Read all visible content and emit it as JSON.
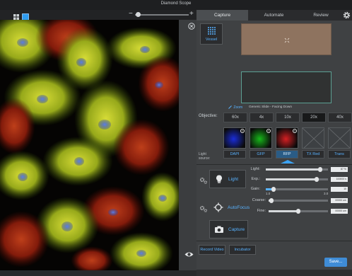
{
  "window": {
    "title": "Diamond Scope"
  },
  "view": {
    "zoom_minus": "−",
    "zoom_plus": "+",
    "zoom_level": 0.05,
    "grid_icon": "grid-view-icon",
    "single_icon": "single-view-icon"
  },
  "tabs": [
    {
      "label": "Capture",
      "active": true
    },
    {
      "label": "Automate",
      "active": false
    },
    {
      "label": "Review",
      "active": false
    }
  ],
  "vessel": {
    "label": "Vessel"
  },
  "slide": {
    "zoom_link": "Zoom",
    "caption": "Generic Slide - Facing Down"
  },
  "objective": {
    "label": "Objective:",
    "options": [
      {
        "label": "60x",
        "active": false
      },
      {
        "label": "4x",
        "active": false
      },
      {
        "label": "10x",
        "active": false
      },
      {
        "label": "20x",
        "active": true
      },
      {
        "label": "40x",
        "active": false
      }
    ]
  },
  "light_source": {
    "label_line1": "Light",
    "label_line2": "source:",
    "filters": [
      {
        "label": "DAPI",
        "color": "#1a2dd8",
        "active": false,
        "empty": false
      },
      {
        "label": "GFP",
        "color": "#17b81a",
        "active": false,
        "empty": false
      },
      {
        "label": "RFP",
        "color": "#d41f22",
        "active": true,
        "empty": false
      },
      {
        "label": "TX Red",
        "color": "#3d4043",
        "active": false,
        "empty": true
      },
      {
        "label": "Trans",
        "color": "#3d4043",
        "active": false,
        "empty": true
      }
    ]
  },
  "light": {
    "button_label": "Light",
    "sliders": [
      {
        "label": "Light:",
        "value": "87 %",
        "level": 0.87
      },
      {
        "label": "Exp.:",
        "value": "100000 s",
        "level": 0.82
      },
      {
        "label": "Gain:",
        "value": "10",
        "level": 0.12,
        "tick_min": "1.0",
        "tick_max": "3.0"
      }
    ]
  },
  "autofocus": {
    "button_label": "AutoFocus",
    "sliders": [
      {
        "label": "Coarse:",
        "value": "00000 um",
        "level": 0.05
      },
      {
        "label": "Fine:",
        "value": "00000 um",
        "level": 0.5
      }
    ]
  },
  "capture": {
    "button_label": "Capture"
  },
  "record": {
    "record_video": "Record Video",
    "incubator": "Incubator"
  },
  "save": {
    "label": "Save..."
  },
  "colors": {
    "accent": "#58b2ff",
    "primary_button": "#3f8cd6",
    "panel_bg": "#3f4143"
  }
}
